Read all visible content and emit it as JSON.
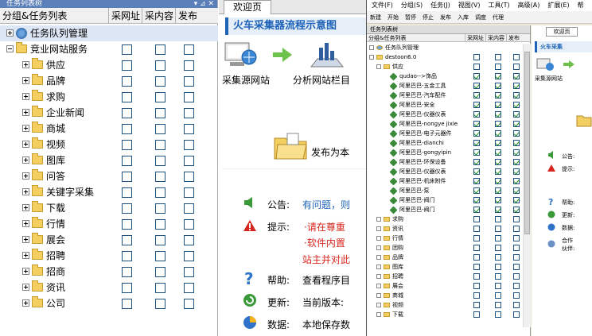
{
  "left_panel": {
    "title": "任务列表树",
    "columns": [
      "分组&任务列表",
      "采网址",
      "采内容",
      "发布"
    ],
    "rows": [
      {
        "label": "任务队列管理",
        "type": "gear",
        "level": 0,
        "expander": "plus",
        "checkboxes": false,
        "selected": true
      },
      {
        "label": "竞业网站服务",
        "type": "folder",
        "level": 0,
        "expander": "minus",
        "checkboxes": true
      },
      {
        "label": "供应",
        "type": "folder",
        "level": 1,
        "expander": "plus",
        "checkboxes": true
      },
      {
        "label": "品牌",
        "type": "folder",
        "level": 1,
        "expander": "plus",
        "checkboxes": true
      },
      {
        "label": "求购",
        "type": "folder",
        "level": 1,
        "expander": "plus",
        "checkboxes": true
      },
      {
        "label": "企业新闻",
        "type": "folder",
        "level": 1,
        "expander": "plus",
        "checkboxes": true
      },
      {
        "label": "商城",
        "type": "folder",
        "level": 1,
        "expander": "plus",
        "checkboxes": true
      },
      {
        "label": "视频",
        "type": "folder",
        "level": 1,
        "expander": "plus",
        "checkboxes": true
      },
      {
        "label": "图库",
        "type": "folder",
        "level": 1,
        "expander": "plus",
        "checkboxes": true
      },
      {
        "label": "问答",
        "type": "folder",
        "level": 1,
        "expander": "plus",
        "checkboxes": true
      },
      {
        "label": "关键字采集",
        "type": "folder",
        "level": 1,
        "expander": "plus",
        "checkboxes": true
      },
      {
        "label": "下载",
        "type": "folder",
        "level": 1,
        "expander": "plus",
        "checkboxes": true
      },
      {
        "label": "行情",
        "type": "folder",
        "level": 1,
        "expander": "plus",
        "checkboxes": true
      },
      {
        "label": "展会",
        "type": "folder",
        "level": 1,
        "expander": "plus",
        "checkboxes": true
      },
      {
        "label": "招聘",
        "type": "folder",
        "level": 1,
        "expander": "plus",
        "checkboxes": true
      },
      {
        "label": "招商",
        "type": "folder",
        "level": 1,
        "expander": "plus",
        "checkboxes": true
      },
      {
        "label": "资讯",
        "type": "folder",
        "level": 1,
        "expander": "plus",
        "checkboxes": true
      },
      {
        "label": "公司",
        "type": "folder",
        "level": 1,
        "expander": "plus",
        "checkboxes": true
      }
    ]
  },
  "middle_panel": {
    "tab": "欢迎页",
    "banner": "火车采集器流程示意图",
    "flow": {
      "step1": "采集源网站",
      "step2": "分析网站栏目",
      "step3": "发布为本"
    },
    "info": {
      "notice_label": "公告:",
      "notice_text": "有问题，则",
      "tip_label": "提示:",
      "tip_line1": "·请在尊重",
      "tip_line2": "·软件内置",
      "tip_line3": "站主并对此",
      "help_label": "帮助:",
      "help_text": "查看程序目",
      "update_label": "更新:",
      "update_text": "当前版本:",
      "data_label": "数据:",
      "data_text": "本地保存数"
    }
  },
  "right_window": {
    "menu": [
      "文件(F)",
      "分组(S)",
      "任务(J)",
      "视图(V)",
      "工具(T)",
      "高级(A)",
      "扩展(E)",
      "帮"
    ],
    "toolbar": [
      "新建",
      "开始",
      "暂停",
      "停止",
      "发布",
      "入库",
      "调度",
      "代理"
    ],
    "tree_title": "任务列表树",
    "columns": [
      "分组&任务列表",
      "采网址",
      "采内容",
      "发布"
    ],
    "rows": [
      {
        "label": "任务队列管理",
        "type": "gear",
        "level": 0,
        "cb": null
      },
      {
        "label": "destoon6.0",
        "type": "folder",
        "level": 0,
        "cb": [
          false,
          false,
          false
        ]
      },
      {
        "label": "供应",
        "type": "folder",
        "level": 1,
        "cb": [
          false,
          false,
          false
        ]
      },
      {
        "label": "qudao-->饰品",
        "type": "leaf",
        "level": 2,
        "cb": [
          true,
          true,
          true
        ]
      },
      {
        "label": "阿里巴巴-五金工具",
        "type": "leaf",
        "level": 2,
        "cb": [
          true,
          true,
          true
        ]
      },
      {
        "label": "阿里巴巴-汽车配件",
        "type": "leaf",
        "level": 2,
        "cb": [
          true,
          true,
          true
        ]
      },
      {
        "label": "阿里巴巴-安全",
        "type": "leaf",
        "level": 2,
        "cb": [
          true,
          true,
          true
        ]
      },
      {
        "label": "阿里巴巴-仪器仪表",
        "type": "leaf",
        "level": 2,
        "cb": [
          true,
          true,
          true
        ]
      },
      {
        "label": "阿里巴巴-nongye jixie",
        "type": "leaf",
        "level": 2,
        "cb": [
          true,
          true,
          true
        ]
      },
      {
        "label": "阿里巴巴-电子元器件",
        "type": "leaf",
        "level": 2,
        "cb": [
          true,
          true,
          true
        ]
      },
      {
        "label": "阿里巴巴-dianchi",
        "type": "leaf",
        "level": 2,
        "cb": [
          true,
          true,
          true
        ]
      },
      {
        "label": "阿里巴巴-gongyipin",
        "type": "leaf",
        "level": 2,
        "cb": [
          true,
          true,
          true
        ]
      },
      {
        "label": "阿里巴巴-环保设备",
        "type": "leaf",
        "level": 2,
        "cb": [
          true,
          true,
          true
        ]
      },
      {
        "label": "阿里巴巴-仪器仪表",
        "type": "leaf",
        "level": 2,
        "cb": [
          true,
          true,
          true
        ]
      },
      {
        "label": "阿里巴巴-机床附件",
        "type": "leaf",
        "level": 2,
        "cb": [
          true,
          true,
          true
        ]
      },
      {
        "label": "阿里巴巴-泵",
        "type": "leaf",
        "level": 2,
        "cb": [
          true,
          true,
          true
        ]
      },
      {
        "label": "阿里巴巴-阀门",
        "type": "leaf",
        "level": 2,
        "cb": [
          true,
          true,
          true
        ]
      },
      {
        "label": "阿里巴巴-阀门",
        "type": "leaf",
        "level": 2,
        "cb": [
          true,
          true,
          true
        ]
      },
      {
        "label": "求购",
        "type": "folder",
        "level": 1,
        "cb": [
          false,
          false,
          false
        ]
      },
      {
        "label": "资讯",
        "type": "folder",
        "level": 1,
        "cb": [
          false,
          false,
          false
        ]
      },
      {
        "label": "行情",
        "type": "folder",
        "level": 1,
        "cb": [
          false,
          false,
          false
        ]
      },
      {
        "label": "团购",
        "type": "folder",
        "level": 1,
        "cb": [
          false,
          false,
          false
        ]
      },
      {
        "label": "品牌",
        "type": "folder",
        "level": 1,
        "cb": [
          false,
          false,
          false
        ]
      },
      {
        "label": "图库",
        "type": "folder",
        "level": 1,
        "cb": [
          false,
          false,
          false
        ]
      },
      {
        "label": "招聘",
        "type": "folder",
        "level": 1,
        "cb": [
          false,
          false,
          false
        ]
      },
      {
        "label": "展会",
        "type": "folder",
        "level": 1,
        "cb": [
          false,
          false,
          false
        ]
      },
      {
        "label": "商城",
        "type": "folder",
        "level": 1,
        "cb": [
          false,
          false,
          false
        ]
      },
      {
        "label": "视频",
        "type": "folder",
        "level": 1,
        "cb": [
          false,
          false,
          false
        ]
      },
      {
        "label": "下载",
        "type": "folder",
        "level": 1,
        "cb": [
          false,
          false,
          false
        ]
      }
    ],
    "pane": {
      "tab": "欢迎页",
      "banner": "火车采集",
      "step1": "采集源网站",
      "notice": "公告:",
      "tip": "提示:",
      "help": "帮助:",
      "update": "更新:",
      "data": "数据:",
      "partner1": "合作",
      "partner2": "伙伴:"
    }
  }
}
